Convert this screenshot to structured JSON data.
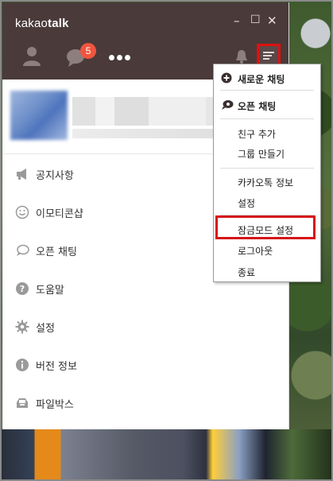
{
  "window": {
    "title_prefix": "kakao",
    "title_suffix": "talk",
    "controls": {
      "minimize": "–",
      "maximize": "☐",
      "close": "✕"
    }
  },
  "header": {
    "tabs": [
      {
        "name": "friends",
        "icon": "person-icon"
      },
      {
        "name": "chats",
        "icon": "chat-bubble-icon",
        "badge": "5"
      },
      {
        "name": "more",
        "icon": "more-dots-icon"
      }
    ],
    "notification_icon": "bell-icon",
    "menu_icon": "menu-icon"
  },
  "side_menu": [
    {
      "label": "공지사항",
      "icon": "megaphone-icon"
    },
    {
      "label": "이모티콘샵",
      "icon": "smiley-icon"
    },
    {
      "label": "오픈 채팅",
      "icon": "open-chat-icon"
    },
    {
      "label": "도움말",
      "icon": "question-icon"
    },
    {
      "label": "설정",
      "icon": "gear-icon"
    },
    {
      "label": "버전 정보",
      "icon": "info-icon"
    },
    {
      "label": "파일박스",
      "icon": "filebox-icon"
    }
  ],
  "dropdown": {
    "items": [
      {
        "label": "새로운 채팅",
        "icon": "new-chat-icon",
        "bold": true
      },
      {
        "label": "오픈 채팅",
        "icon": "open-chat-icon",
        "bold": true
      },
      {
        "label": "친구 추가"
      },
      {
        "label": "그룹 만들기"
      },
      {
        "label": "카카오톡 정보"
      },
      {
        "label": "설정"
      },
      {
        "label": "잠금모드 설정",
        "highlighted": true
      },
      {
        "label": "로그아웃"
      },
      {
        "label": "종료"
      }
    ]
  },
  "colors": {
    "header_bg": "#4a3a3a",
    "badge": "#f0553f",
    "highlight_border": "#d61515"
  }
}
